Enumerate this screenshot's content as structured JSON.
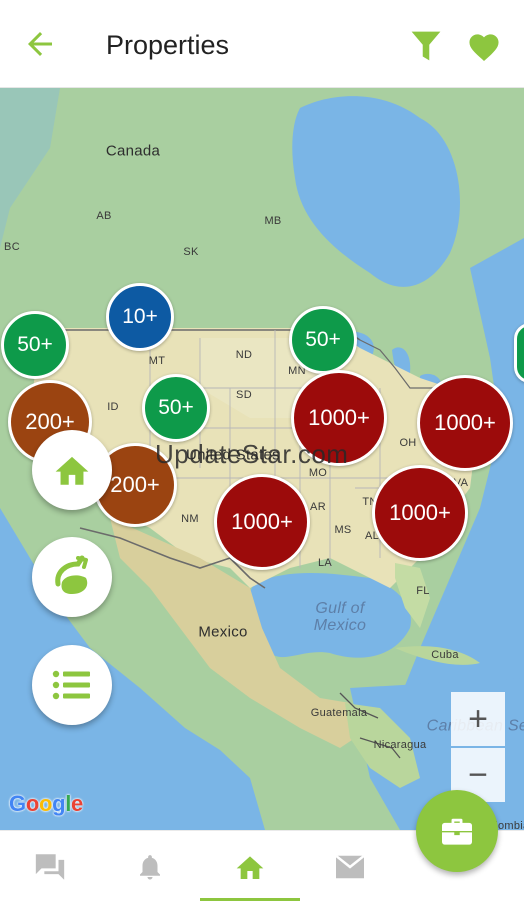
{
  "header": {
    "title": "Properties",
    "back_icon": "arrow-back-icon",
    "filter_icon": "filter-icon",
    "favorite_icon": "heart-icon"
  },
  "colors": {
    "accent": "#8dc63f",
    "cluster_green": "#0e9a4a",
    "cluster_blue": "#0d5aa3",
    "cluster_orange": "#9b4411",
    "cluster_red": "#9c0b0b"
  },
  "map": {
    "labels": {
      "canada": "Canada",
      "ab": "AB",
      "bc": "BC",
      "sk": "SK",
      "mb": "MB",
      "mt": "MT",
      "nd": "ND",
      "mn": "MN",
      "id": "ID",
      "sd": "SD",
      "united_states": "United States",
      "oh": "OH",
      "mo": "MO",
      "nm": "NM",
      "ar": "AR",
      "ms": "MS",
      "al": "AL",
      "la": "LA",
      "va": "VA",
      "tn": "TN",
      "fl": "FL",
      "mexico": "Mexico",
      "gulf": "Gulf of Mexico",
      "cuba": "Cuba",
      "guatemala": "Guatemala",
      "nicaragua": "Nicaragua",
      "caribbean": "Caribbean Sea",
      "colombia": "Colombia"
    },
    "watermark": "UpdateStar.com",
    "google": [
      "G",
      "o",
      "o",
      "g",
      "l",
      "e"
    ],
    "clusters": [
      {
        "id": "c1",
        "label": "50+",
        "color": "green"
      },
      {
        "id": "c2",
        "label": "10+",
        "color": "blue"
      },
      {
        "id": "c3",
        "label": "50+",
        "color": "green"
      },
      {
        "id": "c4",
        "label": "200+",
        "color": "orange"
      },
      {
        "id": "c5",
        "label": "50+",
        "color": "green"
      },
      {
        "id": "c6",
        "label": "1000+",
        "color": "red"
      },
      {
        "id": "c7",
        "label": "1000+",
        "color": "red"
      },
      {
        "id": "c8",
        "label": "200+",
        "color": "orange"
      },
      {
        "id": "c9",
        "label": "1000+",
        "color": "red"
      },
      {
        "id": "c10",
        "label": "1000+",
        "color": "red"
      }
    ],
    "zoom_in": "+",
    "zoom_out": "−"
  },
  "fabs": {
    "home": "home-icon",
    "draw": "draw-area-icon",
    "list": "list-icon",
    "briefcase": "briefcase-icon"
  },
  "bottom_nav": [
    {
      "name": "chat",
      "icon": "chat-icon",
      "active": false
    },
    {
      "name": "notifications",
      "icon": "bell-icon",
      "active": false
    },
    {
      "name": "home",
      "icon": "home-icon",
      "active": true
    },
    {
      "name": "messages",
      "icon": "mail-icon",
      "active": false
    }
  ]
}
